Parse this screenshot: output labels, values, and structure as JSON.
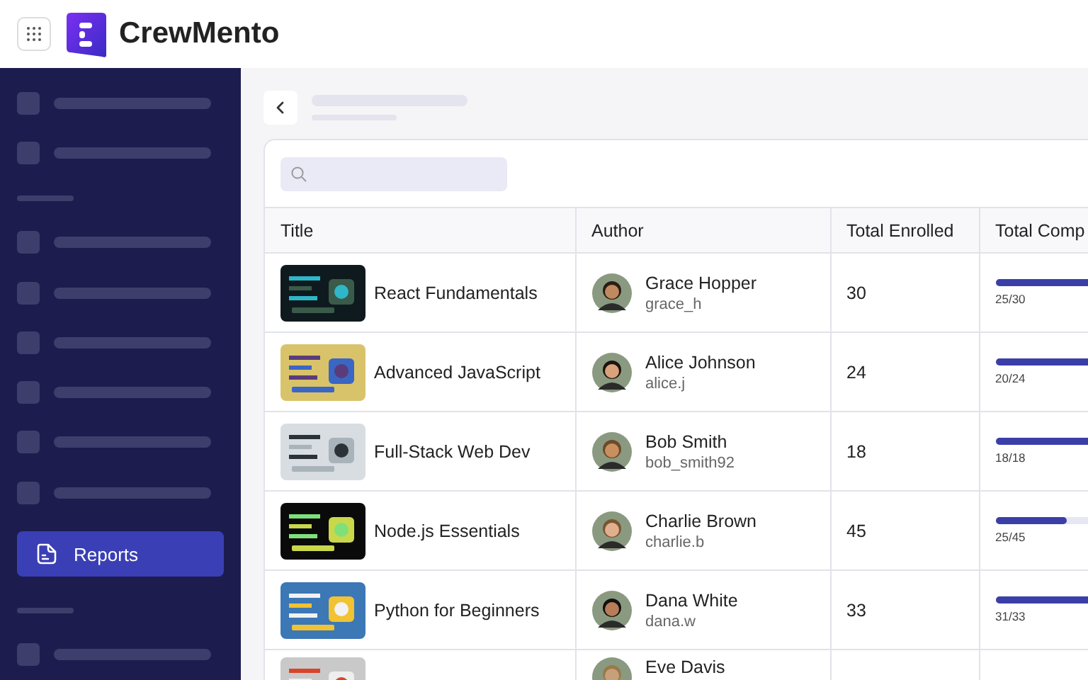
{
  "app": {
    "name": "CrewMento"
  },
  "sidebar": {
    "items": [
      {
        "label": "Reports",
        "selected": true
      }
    ]
  },
  "table": {
    "columns": [
      "Title",
      "Author",
      "Total Enrolled",
      "Total Comp"
    ],
    "rows": [
      {
        "title": "React Fundamentals",
        "author": "Grace Hopper",
        "username": "grace_h",
        "enrolled": "30",
        "completed": "25/30",
        "level": 0.83
      },
      {
        "title": "Advanced JavaScript",
        "author": "Alice Johnson",
        "username": "alice.j",
        "enrolled": "24",
        "completed": "20/24",
        "level": 0.83
      },
      {
        "title": "Full-Stack Web Dev",
        "author": "Bob Smith",
        "username": "bob_smith92",
        "enrolled": "18",
        "completed": "18/18",
        "level": 1
      },
      {
        "title": "Node.js Essentials",
        "author": "Charlie Brown",
        "username": "charlie.b",
        "enrolled": "45",
        "completed": "25/45",
        "level": 0.56
      },
      {
        "title": "Python for Beginners",
        "author": "Dana White",
        "username": "dana.w",
        "enrolled": "33",
        "completed": "31/33",
        "level": 0.94
      },
      {
        "author": "Eve Davis"
      }
    ]
  }
}
